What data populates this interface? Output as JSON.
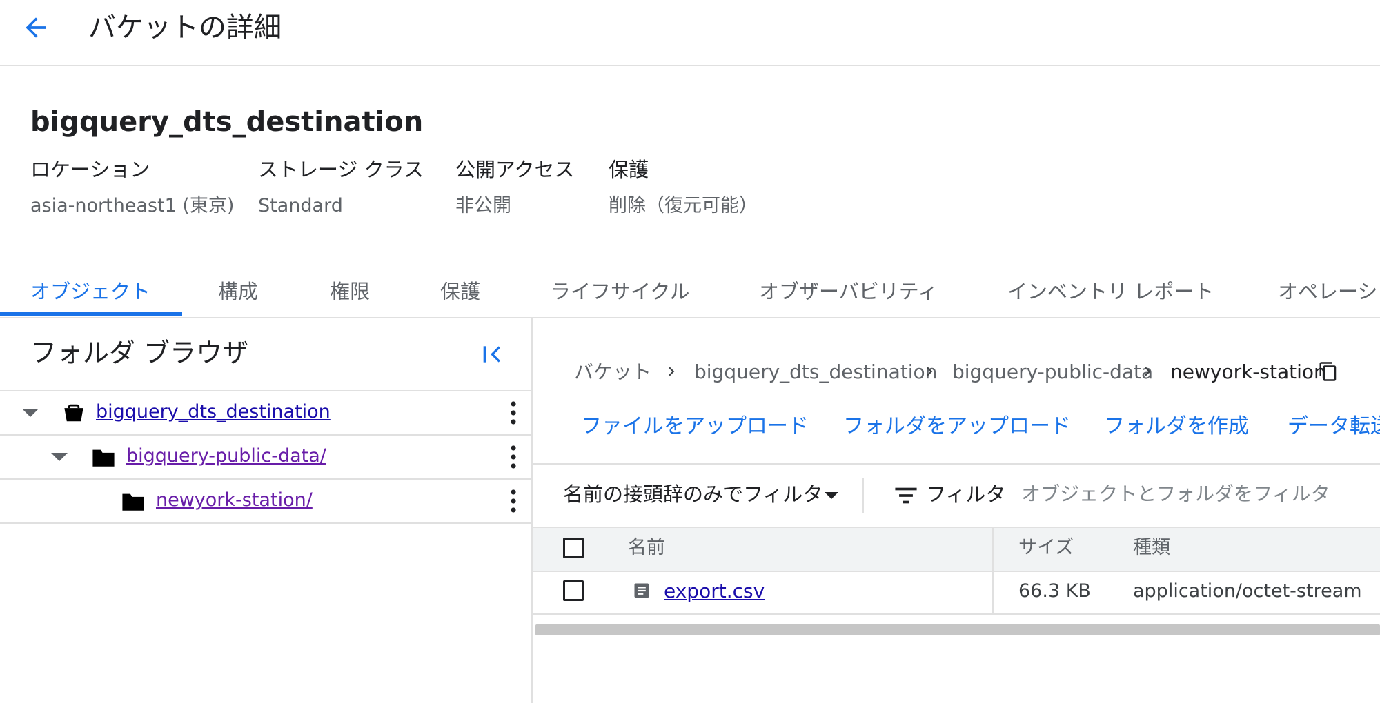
{
  "header": {
    "title": "バケットの詳細"
  },
  "bucket": {
    "name": "bigquery_dts_destination",
    "meta": [
      {
        "label": "ロケーション",
        "value": "asia-northeast1 (東京)"
      },
      {
        "label": "ストレージ クラス",
        "value": "Standard"
      },
      {
        "label": "公開アクセス",
        "value": "非公開"
      },
      {
        "label": "保護",
        "value": "削除（復元可能）"
      }
    ]
  },
  "tabs": [
    {
      "label": "オブジェクト",
      "active": true
    },
    {
      "label": "構成"
    },
    {
      "label": "権限"
    },
    {
      "label": "保護"
    },
    {
      "label": "ライフサイクル"
    },
    {
      "label": "オブザーバビリティ"
    },
    {
      "label": "インベントリ レポート"
    },
    {
      "label": "オペレーション"
    }
  ],
  "folder_browser": {
    "title": "フォルダ ブラウザ",
    "items": [
      {
        "label": "bigquery_dts_destination",
        "icon": "bucket-icon"
      },
      {
        "label": "bigquery-public-data/",
        "icon": "folder-icon"
      },
      {
        "label": "newyork-station/",
        "icon": "folder-icon"
      }
    ]
  },
  "breadcrumb": {
    "items": [
      "バケット",
      "bigquery_dts_destination",
      "bigquery-public-data",
      "newyork-station"
    ]
  },
  "actions": {
    "upload_files": "ファイルをアップロード",
    "upload_folder": "フォルダをアップロード",
    "create_folder": "フォルダを作成",
    "transfer_data": "データ転送"
  },
  "filter_bar": {
    "prefix_filter": "名前の接頭辞のみでフィルタ",
    "filter_label": "フィルタ",
    "placeholder": "オブジェクトとフォルダをフィルタ"
  },
  "table": {
    "columns": [
      "名前",
      "サイズ",
      "種類"
    ],
    "rows": [
      {
        "name": "export.csv",
        "size": "66.3 KB",
        "type": "application/octet-stream"
      }
    ]
  },
  "colors": {
    "accent": "#1a73e8",
    "link": "#1a0dab",
    "visited_link": "#681da8"
  }
}
